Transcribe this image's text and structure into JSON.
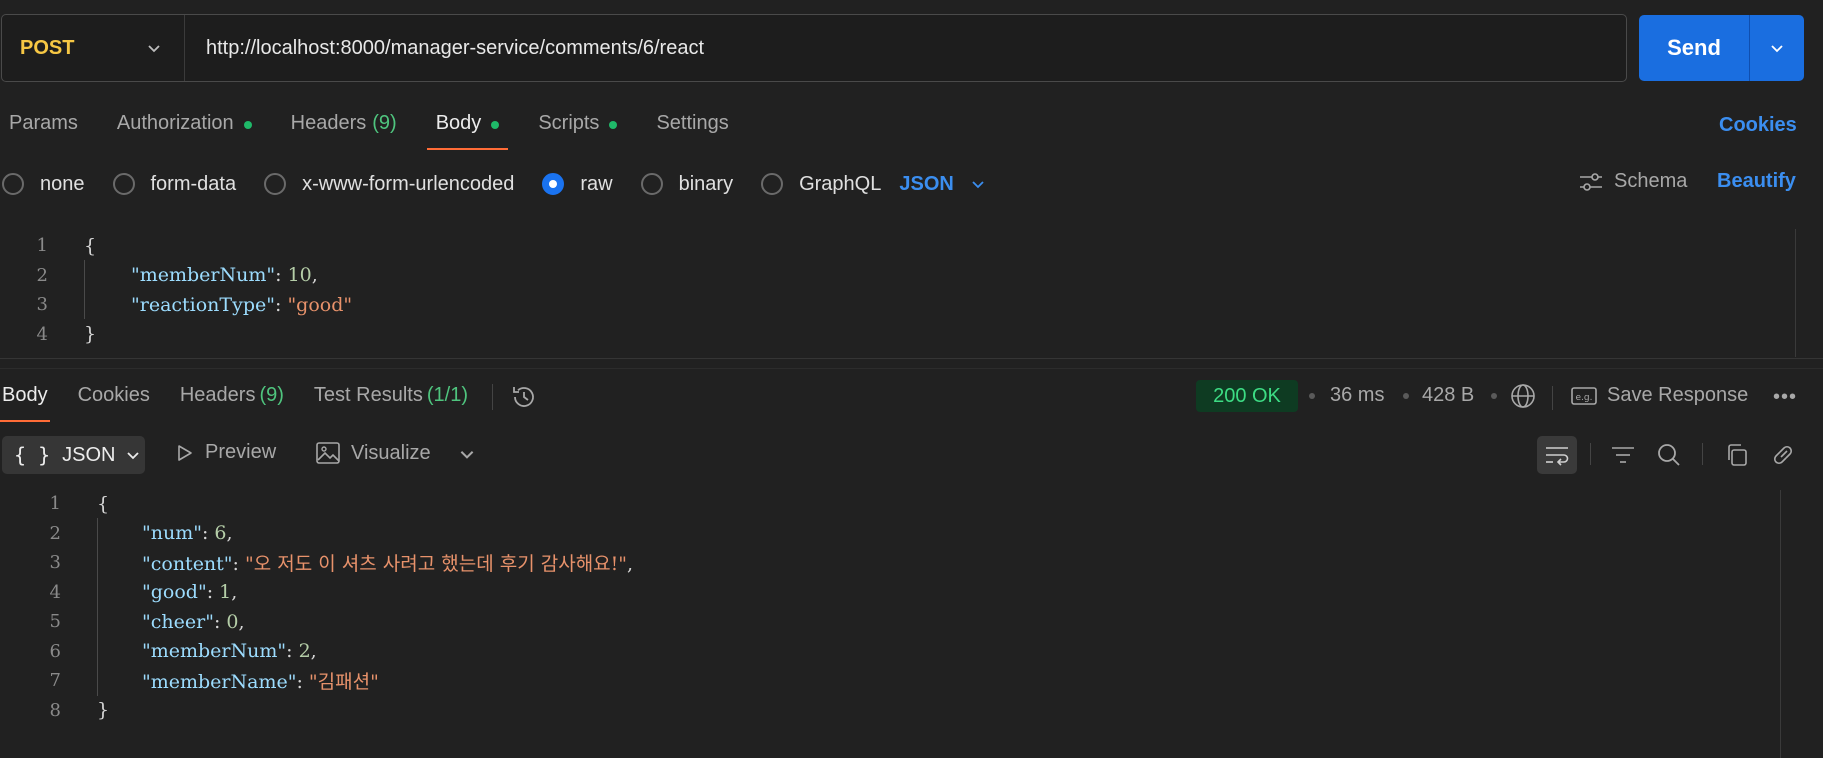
{
  "request": {
    "method": "POST",
    "url": "http://localhost:8000/manager-service/comments/6/react",
    "send_label": "Send"
  },
  "request_tabs": [
    {
      "label": "Params",
      "dot": false,
      "count": ""
    },
    {
      "label": "Authorization",
      "dot": true,
      "count": ""
    },
    {
      "label": "Headers",
      "dot": false,
      "count": "(9)"
    },
    {
      "label": "Body",
      "dot": true,
      "count": "",
      "active": true
    },
    {
      "label": "Scripts",
      "dot": true,
      "count": ""
    },
    {
      "label": "Settings",
      "dot": false,
      "count": ""
    }
  ],
  "cookies_link": "Cookies",
  "body_types": {
    "options": [
      "none",
      "form-data",
      "x-www-form-urlencoded",
      "raw",
      "binary",
      "GraphQL"
    ],
    "selected": "raw",
    "format": "JSON"
  },
  "schema_label": "Schema",
  "beautify_label": "Beautify",
  "request_body": {
    "line_numbers": [
      "1",
      "2",
      "3",
      "4"
    ],
    "open": "{",
    "close": "}",
    "fields": [
      {
        "key": "\"memberNum\"",
        "value": "10",
        "type": "num",
        "comma": ","
      },
      {
        "key": "\"reactionType\"",
        "value": "\"good\"",
        "type": "str",
        "comma": ""
      }
    ]
  },
  "response_tabs": [
    {
      "label": "Body",
      "count": "",
      "active": true
    },
    {
      "label": "Cookies",
      "count": ""
    },
    {
      "label": "Headers",
      "count": "(9)"
    },
    {
      "label": "Test Results",
      "count": "(1/1)"
    }
  ],
  "response_meta": {
    "status": "200 OK",
    "time": "36 ms",
    "size": "428 B",
    "save_label": "Save Response",
    "more": "•••"
  },
  "response_toolbar": {
    "format": "JSON",
    "format_icon": "{ }",
    "preview": "Preview",
    "visualize": "Visualize"
  },
  "response_body": {
    "line_numbers": [
      "1",
      "2",
      "3",
      "4",
      "5",
      "6",
      "7",
      "8"
    ],
    "open": "{",
    "close": "}",
    "fields": [
      {
        "key": "\"num\"",
        "value": "6",
        "type": "num",
        "comma": ","
      },
      {
        "key": "\"content\"",
        "value": "\"오 저도 이 셔츠 사려고 했는데 후기 감사해요!\"",
        "type": "str",
        "comma": ","
      },
      {
        "key": "\"good\"",
        "value": "1",
        "type": "num",
        "comma": ","
      },
      {
        "key": "\"cheer\"",
        "value": "0",
        "type": "num",
        "comma": ","
      },
      {
        "key": "\"memberNum\"",
        "value": "2",
        "type": "num",
        "comma": ","
      },
      {
        "key": "\"memberName\"",
        "value": "\"김패션\"",
        "type": "str",
        "comma": ""
      }
    ]
  },
  "colors": {
    "accent_orange": "#ff6c37",
    "link_blue": "#3b8ef0",
    "send_blue": "#1a6ee0",
    "method_yellow": "#f6c744",
    "status_green": "#3ddc84",
    "dot_green": "#1fb969"
  }
}
